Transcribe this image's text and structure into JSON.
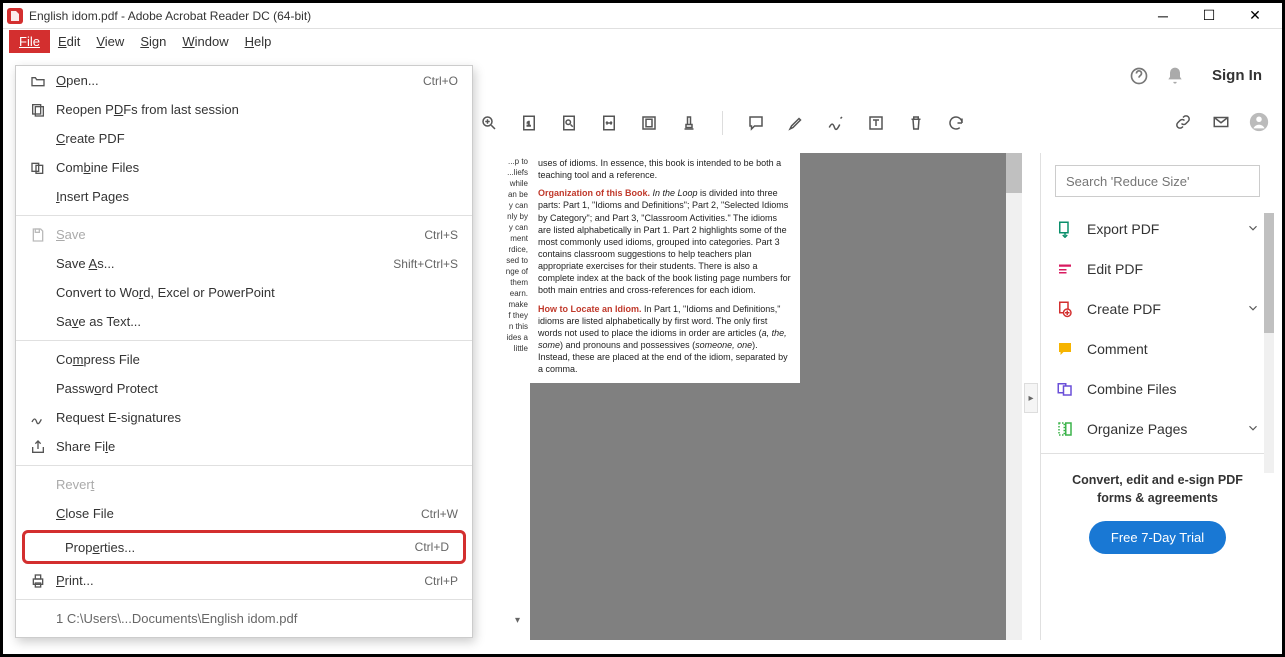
{
  "titlebar": {
    "title": "English idom.pdf - Adobe Acrobat Reader DC (64-bit)"
  },
  "menubar": {
    "file": "File",
    "edit": "Edit",
    "view": "View",
    "sign": "Sign",
    "window": "Window",
    "help": "Help"
  },
  "file_menu": {
    "open": "Open...",
    "open_sc": "Ctrl+O",
    "reopen": "Reopen PDFs from last session",
    "create": "Create PDF",
    "combine": "Combine Files",
    "insert": "Insert Pages",
    "save": "Save",
    "save_sc": "Ctrl+S",
    "save_as": "Save As...",
    "save_as_sc": "Shift+Ctrl+S",
    "convert": "Convert to Word, Excel or PowerPoint",
    "save_text": "Save as Text...",
    "compress": "Compress File",
    "password": "Password Protect",
    "esig": "Request E-signatures",
    "share": "Share File",
    "revert": "Revert",
    "close": "Close File",
    "close_sc": "Ctrl+W",
    "properties": "Properties...",
    "properties_sc": "Ctrl+D",
    "print": "Print...",
    "print_sc": "Ctrl+P",
    "recent1": "1 C:\\Users\\...Documents\\English idom.pdf"
  },
  "toolbar": {
    "signin": "Sign In"
  },
  "sidebar": {
    "search_placeholder": "Search 'Reduce Size'",
    "items": [
      {
        "label": "Export PDF",
        "icon": "export",
        "chev": true,
        "color": "#0a8f6b"
      },
      {
        "label": "Edit PDF",
        "icon": "edit",
        "chev": false,
        "color": "#d81b60"
      },
      {
        "label": "Create PDF",
        "icon": "create",
        "chev": true,
        "color": "#d32f2f"
      },
      {
        "label": "Comment",
        "icon": "comment",
        "chev": false,
        "color": "#f6b400"
      },
      {
        "label": "Combine Files",
        "icon": "combine",
        "chev": false,
        "color": "#6a4fd8"
      },
      {
        "label": "Organize Pages",
        "icon": "organize",
        "chev": true,
        "color": "#3bb34a"
      }
    ],
    "promo": "Convert, edit and e-sign PDF forms & agreements",
    "trial": "Free 7-Day Trial"
  },
  "document": {
    "gutter_lines": [
      "...p to",
      "...liefs",
      "while",
      "an be",
      "y can",
      "nly by",
      "",
      "y can",
      "ment",
      "rdice,",
      "sed to",
      "nge of",
      "",
      "them",
      "earn.",
      "make",
      "f they",
      "n this",
      "ides a",
      "little"
    ],
    "para1": "uses of idioms. In essence, this book is intended to be both a teaching tool and a reference.",
    "h1": "Organization of this Book.",
    "para2a": " In the Loop",
    "para2b": " is divided into three parts: Part 1, \"Idioms and Definitions\"; Part 2, \"Selected Idioms by Category\"; and Part 3, \"Classroom Activities.\" The idioms are listed alphabetically in Part 1. Part 2 highlights some of the most commonly used idioms, grouped into categories. Part 3 contains classroom suggestions to help teachers plan appropriate exercises for their students. There is also a complete index at the back of the book listing page numbers for both main entries and cross-references for each idiom.",
    "h2": "How to Locate an Idiom.",
    "para3a": " In Part 1, \"Idioms and Definitions,\" idioms are listed alphabetically by first word. The only first words not used to place the idioms in order are articles (",
    "para3_em1": "a, the, some",
    "para3b": ") and pronouns and possessives (",
    "para3_em2": "someone, one",
    "para3c": "). Instead, these are placed at the end of the idiom, separated by a comma."
  }
}
